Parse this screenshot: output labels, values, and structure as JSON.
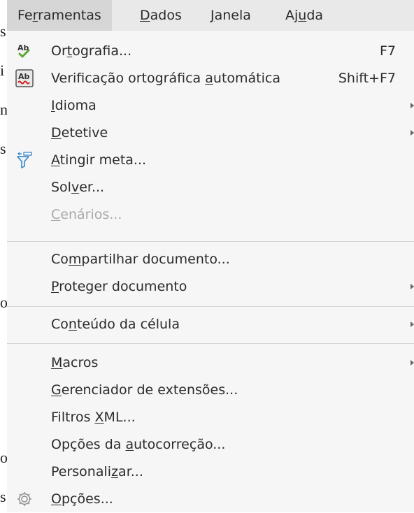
{
  "document_edge": [
    "s",
    "i",
    "n",
    "s",
    "o",
    "o",
    "s"
  ],
  "menubar": {
    "items": [
      {
        "pre": "Fe",
        "acc": "r",
        "post": "ramentas",
        "active": true
      },
      {
        "pre": "",
        "acc": "D",
        "post": "ados"
      },
      {
        "pre": "",
        "acc": "J",
        "post": "anela"
      },
      {
        "pre": "Aj",
        "acc": "u",
        "post": "da"
      }
    ]
  },
  "menu": {
    "items": [
      {
        "pre": "Or",
        "acc": "t",
        "post": "ografia...",
        "shortcut": "F7",
        "icon": "spellcheck-icon"
      },
      {
        "pre": "Verificação ortográfica ",
        "acc": "a",
        "post": "utomática",
        "shortcut": "Shift+F7",
        "icon": "autospellcheck-icon"
      },
      {
        "pre": "",
        "acc": "I",
        "post": "dioma",
        "submenu": true
      },
      {
        "pre": "",
        "acc": "D",
        "post": "etetive",
        "submenu": true
      },
      {
        "pre": "",
        "acc": "A",
        "post": "tingir meta...",
        "icon": "goal-seek-icon"
      },
      {
        "pre": "Sol",
        "acc": "v",
        "post": "er..."
      },
      {
        "pre": "",
        "acc": "C",
        "post": "enários...",
        "disabled": true
      },
      {
        "pre": "Co",
        "acc": "m",
        "post": "partilhar documento..."
      },
      {
        "pre": "",
        "acc": "P",
        "post": "roteger documento",
        "submenu": true
      },
      {
        "pre": "Co",
        "acc": "n",
        "post": "teúdo da célula",
        "submenu": true
      },
      {
        "pre": "",
        "acc": "M",
        "post": "acros",
        "submenu": true
      },
      {
        "pre": "",
        "acc": "G",
        "post": "erenciador de extensões..."
      },
      {
        "pre": "Filtros ",
        "acc": "X",
        "post": "ML..."
      },
      {
        "pre": "Opções da ",
        "acc": "a",
        "post": "utocorreção..."
      },
      {
        "pre": "Personali",
        "acc": "z",
        "post": "ar..."
      },
      {
        "pre": "",
        "acc": "O",
        "post": "pções...",
        "icon": "gear-icon"
      }
    ]
  }
}
